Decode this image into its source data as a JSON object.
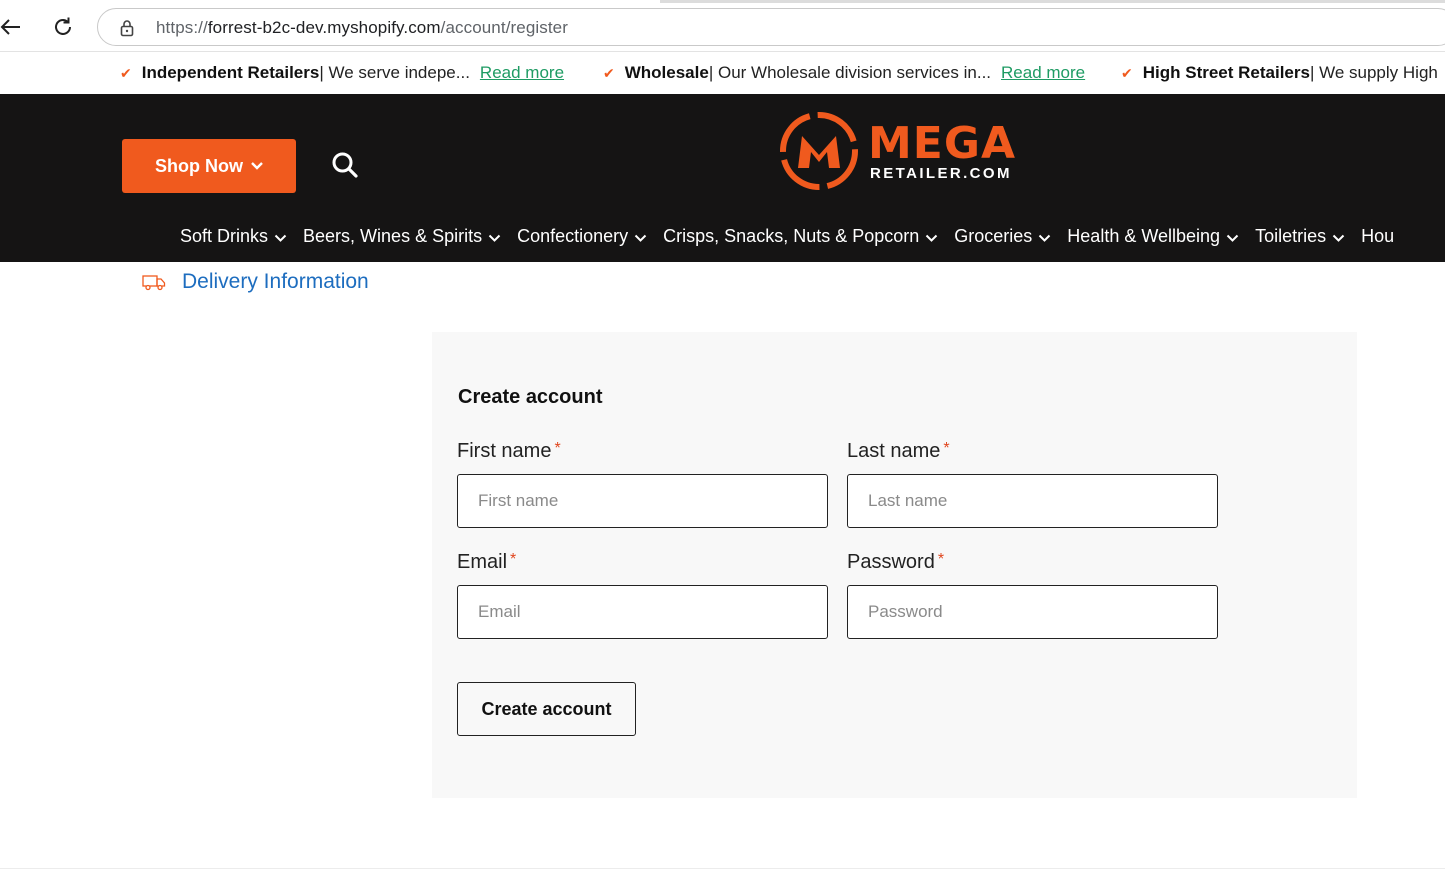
{
  "browser": {
    "url_prefix": "https://",
    "url_host": "forrest-b2c-dev.myshopify.com",
    "url_path": "/account/register"
  },
  "announcements": [
    {
      "title": "Independent Retailers",
      "text": " | We serve indepe...",
      "link": "Read more"
    },
    {
      "title": "Wholesale",
      "text": " | Our Wholesale division services in...",
      "link": "Read more"
    },
    {
      "title": "High Street Retailers",
      "text": " | We supply High",
      "link": ""
    }
  ],
  "header": {
    "shop_now": "Shop Now",
    "logo_word": "MEGA",
    "logo_sub": "RETAILER.COM",
    "menu": [
      "Soft Drinks",
      "Beers, Wines & Spirits",
      "Confectionery",
      "Crisps, Snacks, Nuts & Popcorn",
      "Groceries",
      "Health & Wellbeing",
      "Toiletries",
      "Hou"
    ]
  },
  "delivery": {
    "label": "Delivery Information"
  },
  "form": {
    "title": "Create account",
    "required_mark": "*",
    "first_name": {
      "label": "First name",
      "placeholder": "First name",
      "value": ""
    },
    "last_name": {
      "label": "Last name",
      "placeholder": "Last name",
      "value": ""
    },
    "email": {
      "label": "Email",
      "placeholder": "Email",
      "value": ""
    },
    "password": {
      "label": "Password",
      "placeholder": "Password",
      "value": ""
    },
    "submit_label": "Create account"
  },
  "colors": {
    "accent": "#f05a1e",
    "header_bg": "#151414",
    "link_green": "#1e9b63",
    "link_blue": "#1d6dbf"
  }
}
